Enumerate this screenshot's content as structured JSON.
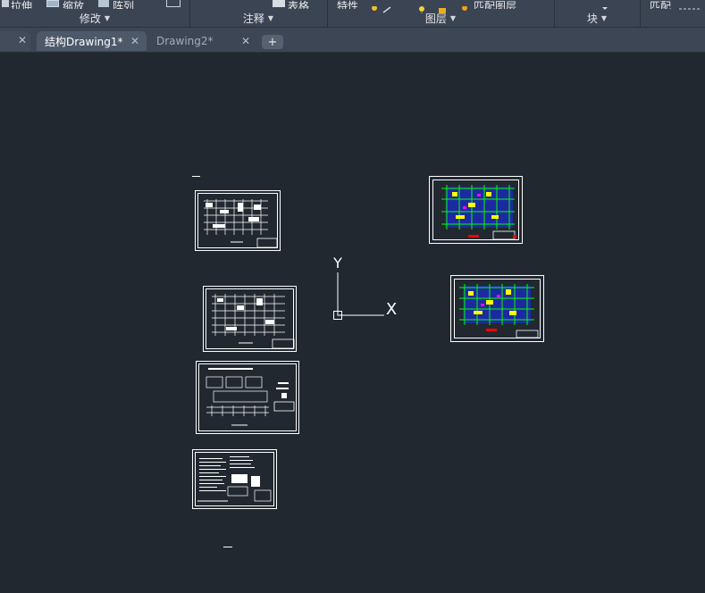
{
  "ribbon": {
    "top_fragments": [
      "拉伸",
      "缩放",
      "阵列",
      "表格",
      "特性",
      "匹配图层",
      "匹配"
    ],
    "panels": [
      "修改",
      "注释",
      "图层",
      "块"
    ]
  },
  "tabs": [
    {
      "label": "结构Drawing1*",
      "active": true
    },
    {
      "label": "Drawing2*",
      "active": false
    }
  ],
  "new_tab": "+",
  "close_glyph": "✕",
  "ucs": {
    "x_label": "X",
    "y_label": "Y"
  },
  "colors": {
    "canvas": "#212830",
    "ribbon": "#3b4453",
    "active_tab": "#4d5869",
    "line_white": "#ffffff",
    "line_green": "#00ff00",
    "line_blue": "#1a2bff",
    "line_yellow": "#ffff00",
    "line_red": "#ff0000"
  }
}
